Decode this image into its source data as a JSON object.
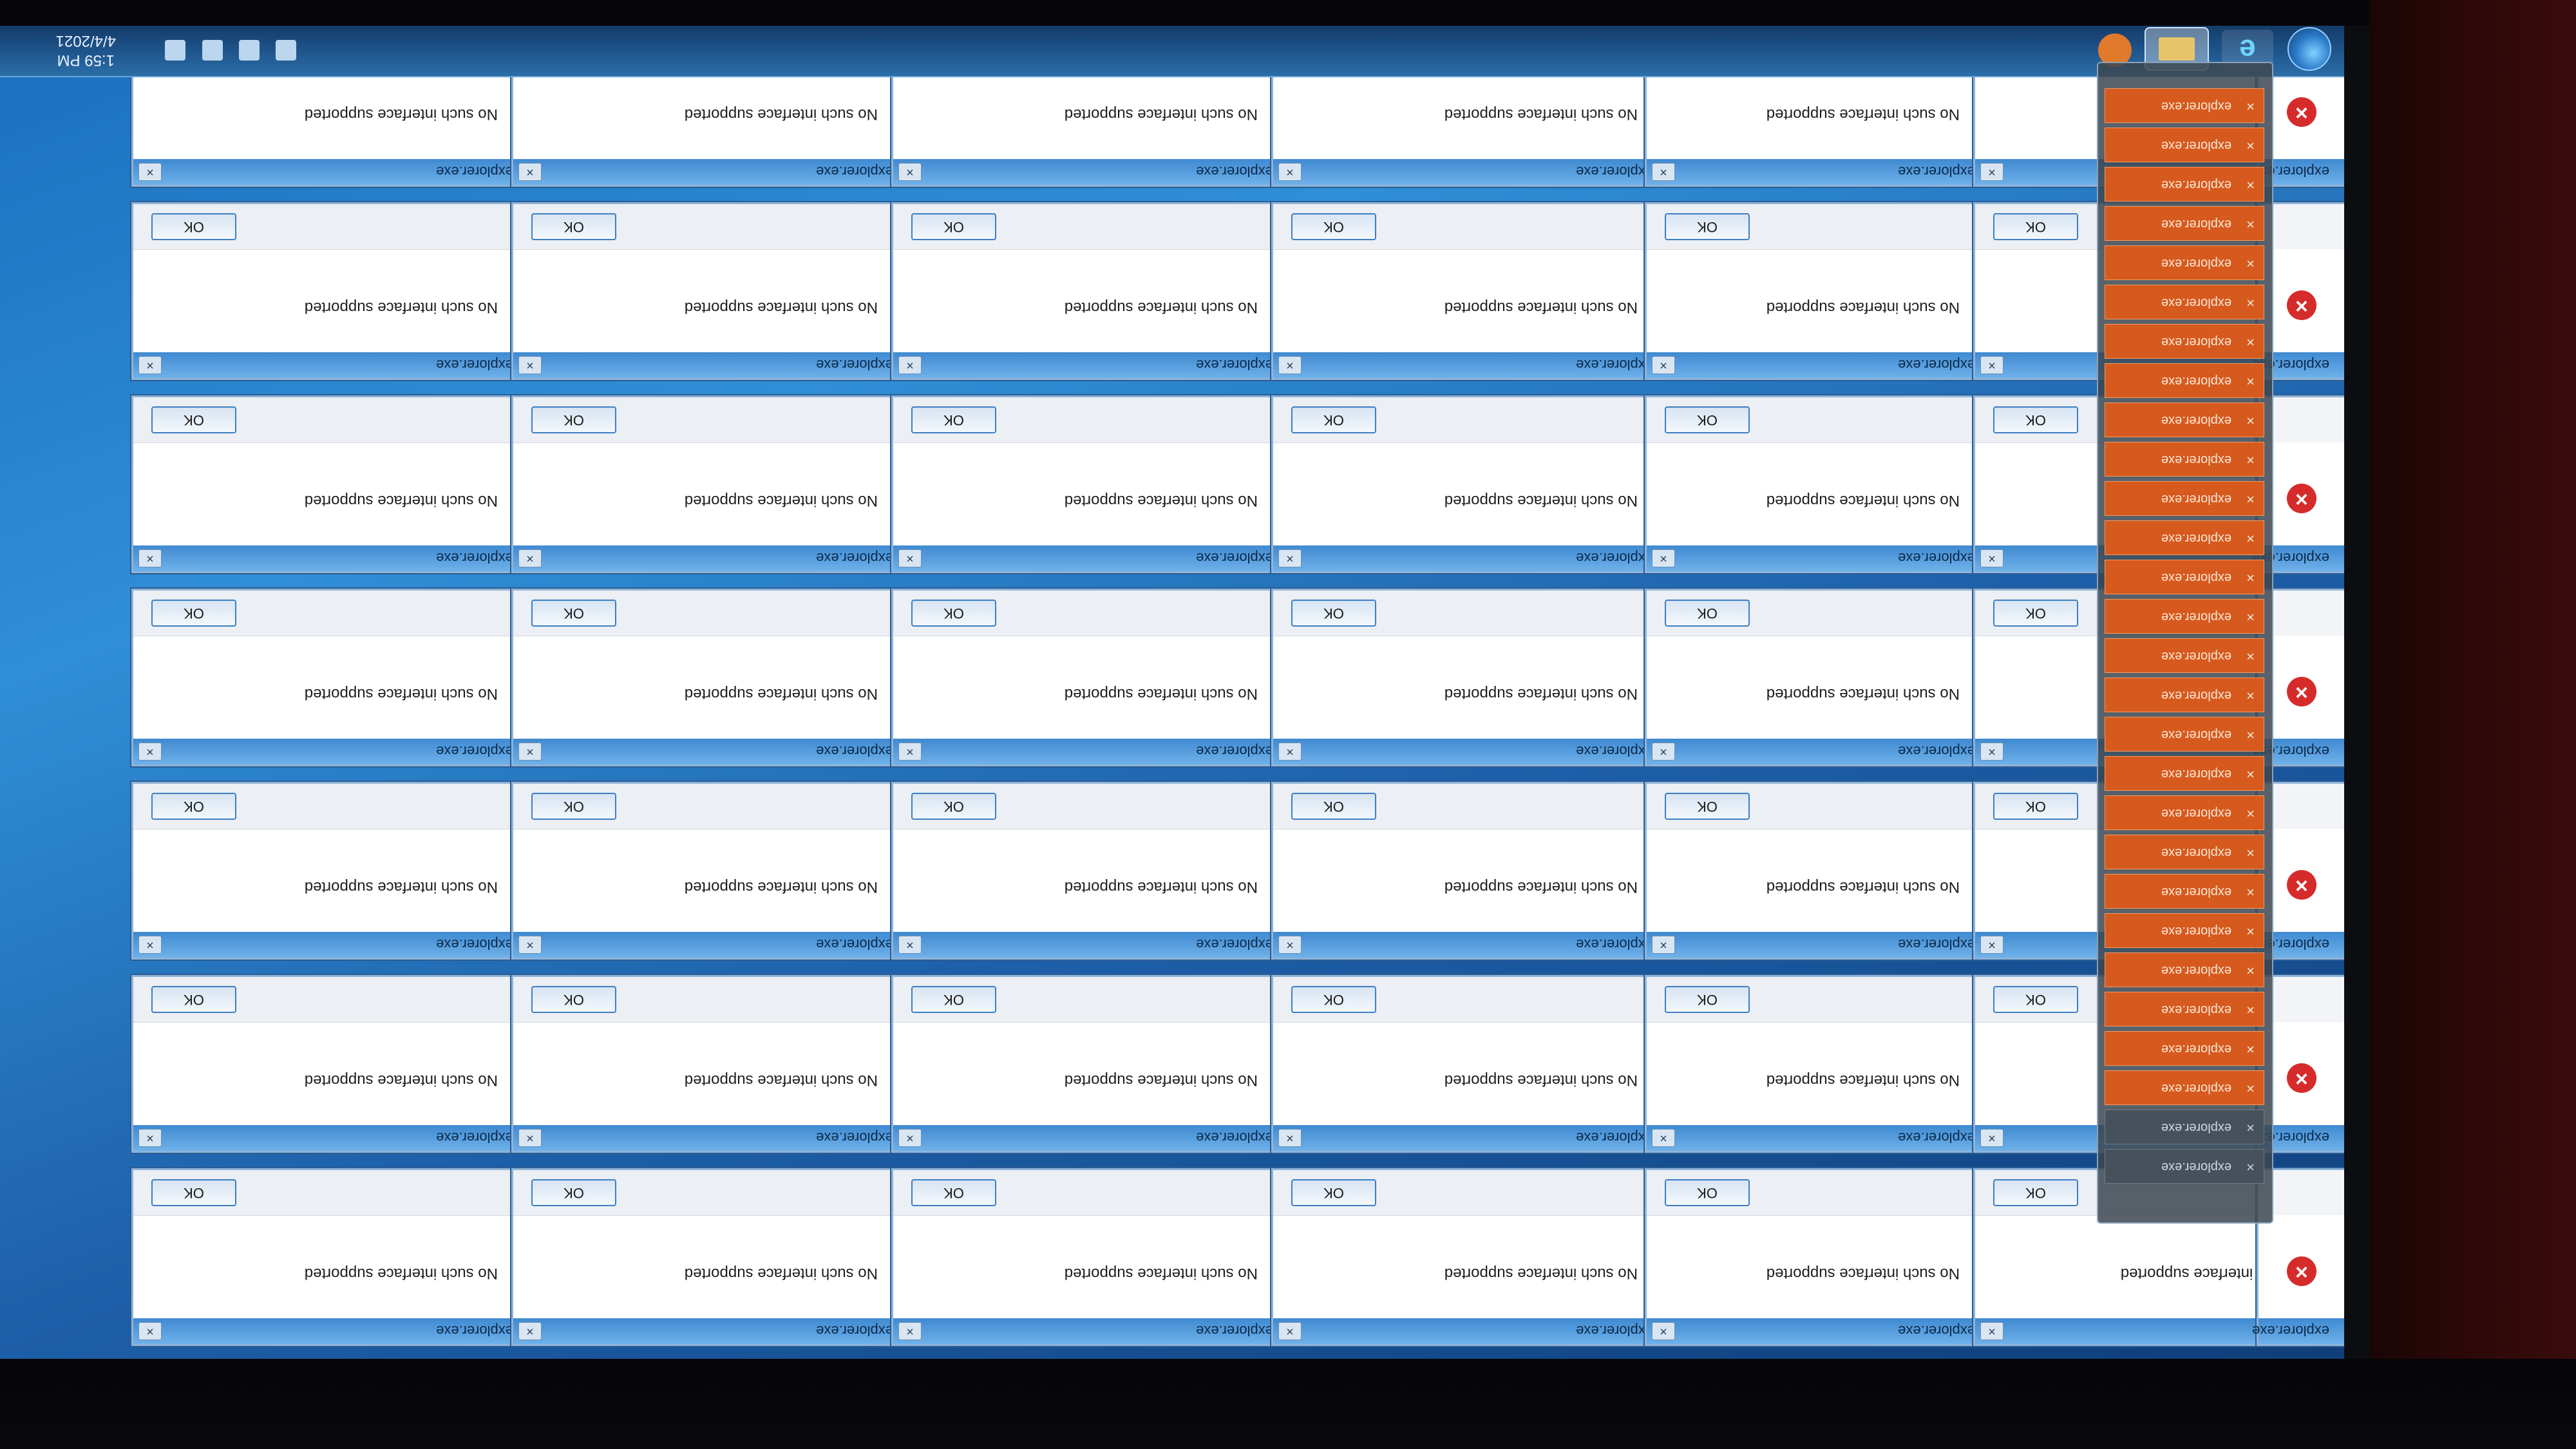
{
  "dialog": {
    "title": "explorer.exe",
    "message": "No such interface supported",
    "ok_label": "OK",
    "close_glyph": "×"
  },
  "taskbar": {
    "ie_glyph": "e",
    "clock_time": "1:59 PM",
    "clock_date": "4/4/2021"
  },
  "jumplist": {
    "item_label": "explorer.exe",
    "close_glyph": "×"
  },
  "icons": [
    "start-orb-icon",
    "internet-explorer-icon",
    "windows-explorer-icon",
    "media-player-icon",
    "volume-icon",
    "network-icon",
    "action-center-icon",
    "error-icon"
  ],
  "colors": {
    "dialog_title": "#3f8ad1",
    "error_red": "#d62b2b",
    "jumplist_orange": "#d65a1e"
  }
}
